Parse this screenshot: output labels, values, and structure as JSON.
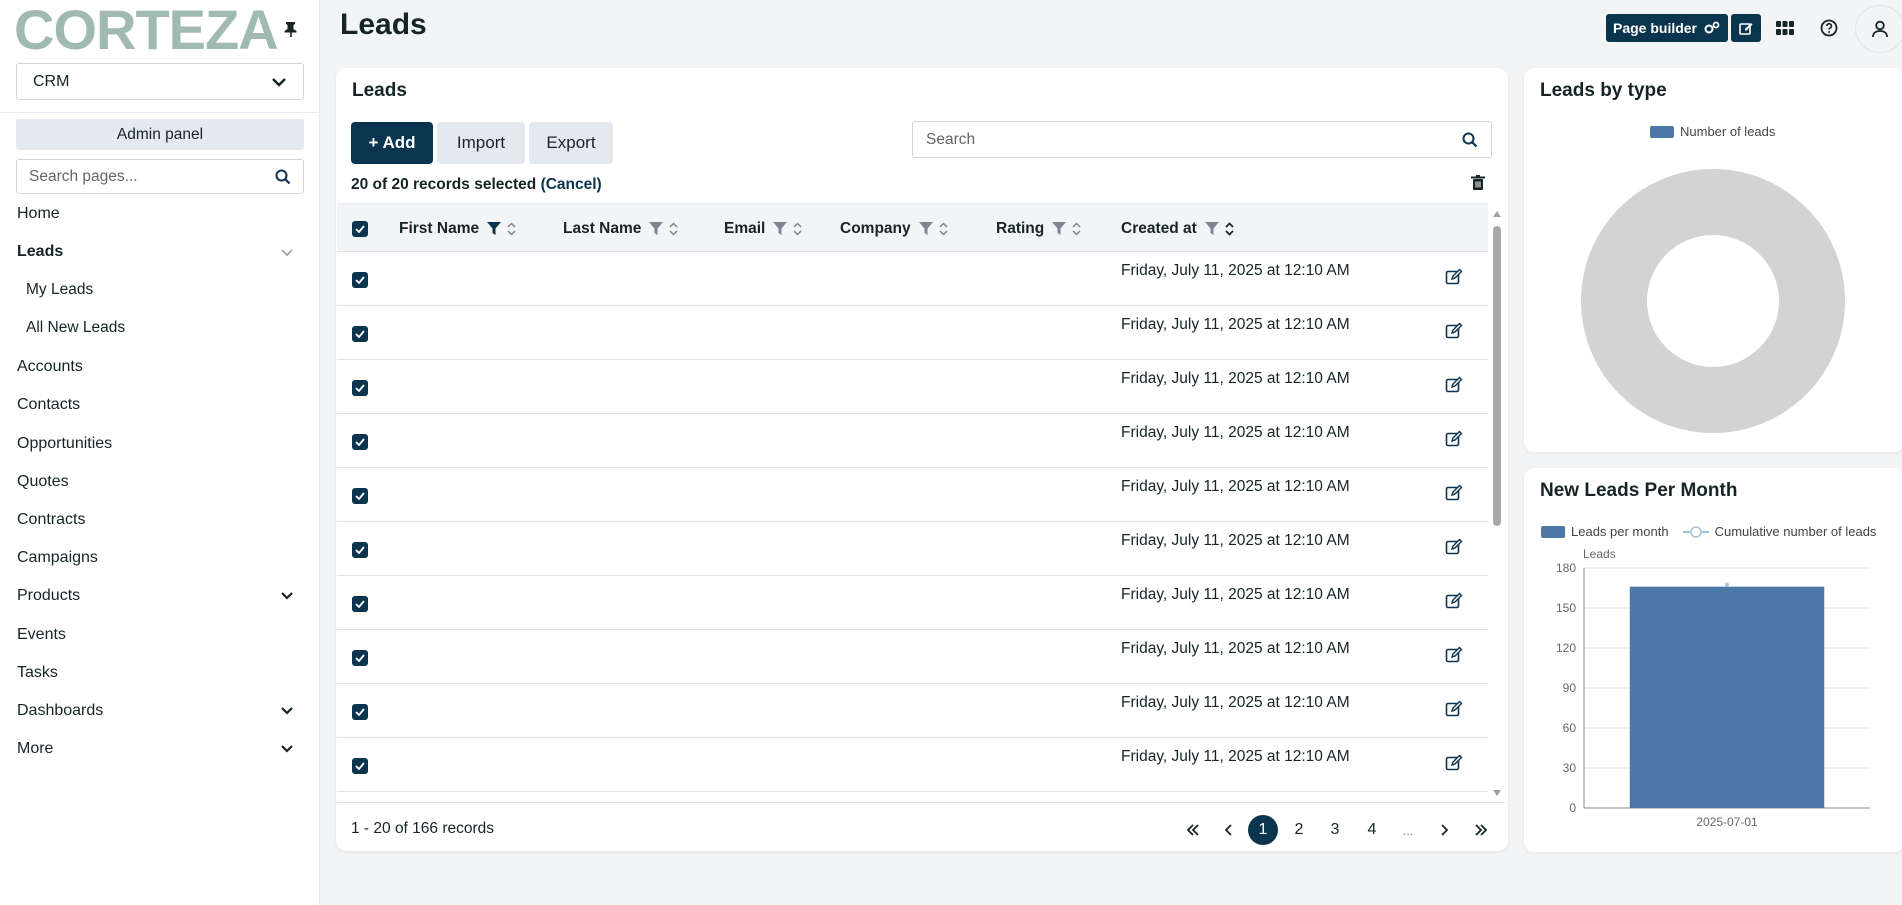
{
  "sidebar": {
    "logo": "CORTEZA",
    "namespace": "CRM",
    "admin_panel": "Admin panel",
    "search_placeholder": "Search pages...",
    "items": [
      {
        "label": "Home"
      },
      {
        "label": "Leads"
      },
      {
        "label": "My Leads"
      },
      {
        "label": "All New Leads"
      },
      {
        "label": "Accounts"
      },
      {
        "label": "Contacts"
      },
      {
        "label": "Opportunities"
      },
      {
        "label": "Quotes"
      },
      {
        "label": "Contracts"
      },
      {
        "label": "Campaigns"
      },
      {
        "label": "Products"
      },
      {
        "label": "Events"
      },
      {
        "label": "Tasks"
      },
      {
        "label": "Dashboards"
      },
      {
        "label": "More"
      }
    ]
  },
  "header": {
    "title": "Leads",
    "page_builder": "Page builder"
  },
  "records": {
    "title": "Leads",
    "add": "+ Add",
    "import": "Import",
    "export": "Export",
    "search_placeholder": "Search",
    "selection": "20 of 20 records selected",
    "cancel": "(Cancel)",
    "columns": [
      "First Name",
      "Last Name",
      "Email",
      "Company",
      "Rating",
      "Created at"
    ],
    "rows": [
      {
        "created_at": "Friday, July 11, 2025 at 12:10 AM"
      },
      {
        "created_at": "Friday, July 11, 2025 at 12:10 AM"
      },
      {
        "created_at": "Friday, July 11, 2025 at 12:10 AM"
      },
      {
        "created_at": "Friday, July 11, 2025 at 12:10 AM"
      },
      {
        "created_at": "Friday, July 11, 2025 at 12:10 AM"
      },
      {
        "created_at": "Friday, July 11, 2025 at 12:10 AM"
      },
      {
        "created_at": "Friday, July 11, 2025 at 12:10 AM"
      },
      {
        "created_at": "Friday, July 11, 2025 at 12:10 AM"
      },
      {
        "created_at": "Friday, July 11, 2025 at 12:10 AM"
      },
      {
        "created_at": "Friday, July 11, 2025 at 12:10 AM"
      }
    ],
    "pagination": {
      "info": "1 - 20 of 166 records",
      "pages": [
        "1",
        "2",
        "3",
        "4",
        "..."
      ],
      "current": "1"
    }
  },
  "leads_by_type": {
    "title": "Leads by type",
    "chart_data": {
      "type": "pie",
      "legend": [
        "Number of leads"
      ],
      "color": "#d3d3d3",
      "legend_color": "#4d77a6"
    }
  },
  "leads_per_month": {
    "title": "New Leads Per Month",
    "chart_data": {
      "type": "bar",
      "categories": [
        "2025-07-01"
      ],
      "series": [
        {
          "name": "Leads per month",
          "values": [
            166
          ],
          "color": "#4d77a6"
        },
        {
          "name": "Cumulative number of leads",
          "values": [
            166
          ],
          "color": "#9ecae1"
        }
      ],
      "ylabel": "Leads",
      "ylim": [
        0,
        180
      ],
      "yticks": [
        "180",
        "150",
        "120",
        "90",
        "60",
        "30",
        "0"
      ]
    }
  }
}
